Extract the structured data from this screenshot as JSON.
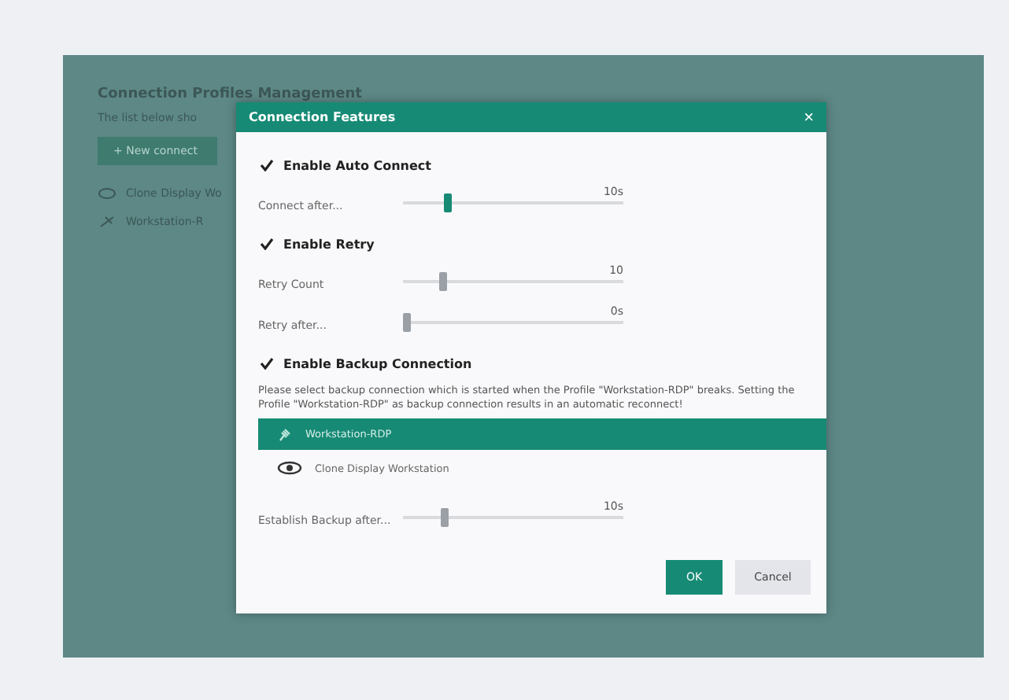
{
  "background": {
    "title": "Connection Profiles Management",
    "subtitle": "The list below sho",
    "new_button": "+ New connect",
    "items": [
      {
        "label": "Clone Display Wo"
      },
      {
        "label": "Workstation-R"
      }
    ]
  },
  "dialog": {
    "title": "Connection Features",
    "close": "×",
    "sections": [
      {
        "label": "Enable Auto Connect",
        "checked": true,
        "sliders": [
          {
            "label": "Connect after...",
            "level": 0.19,
            "reading": "10s",
            "active": true
          }
        ]
      },
      {
        "label": "Enable Retry",
        "checked": true,
        "sliders": [
          {
            "label": "Retry Count",
            "level": 0.17,
            "reading": "10",
            "active": false
          },
          {
            "label": "Retry after...",
            "level": 0,
            "reading": "0s",
            "active": false
          }
        ]
      },
      {
        "label": "Enable Backup Connection",
        "checked": true,
        "description": "Please select backup connection which is started when the Profile \"Workstation-RDP\" breaks. Setting the Profile \"Workstation-RDP\" as backup connection results in an automatic reconnect!",
        "connections": [
          {
            "label": "Workstation-RDP",
            "selected": true,
            "kind": "rdp"
          },
          {
            "label": "Clone Display Workstation",
            "selected": false,
            "kind": "display"
          }
        ],
        "sliders": [
          {
            "label": "Establish Backup after...",
            "level": 0.18,
            "reading": "10s",
            "active": false
          }
        ]
      }
    ],
    "buttons": [
      {
        "label": "OK",
        "kind": "primary"
      },
      {
        "label": "Cancel",
        "kind": "secondary"
      }
    ]
  }
}
